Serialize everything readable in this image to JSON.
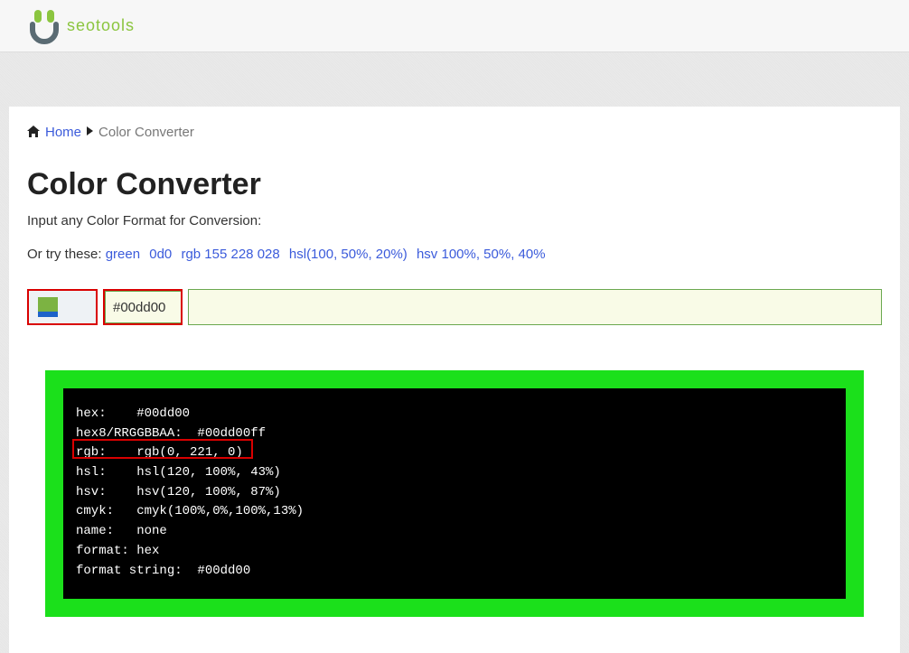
{
  "logo": {
    "text": "seotools"
  },
  "breadcrumb": {
    "home": "Home",
    "current": "Color Converter"
  },
  "title": "Color Converter",
  "subheading": "Input any Color Format for Conversion:",
  "try_label": "Or try these: ",
  "try_examples": {
    "a": "green",
    "b": "0d0",
    "c": "rgb 155 228 028",
    "d": "hsl(100, 50%, 20%)",
    "e": "hsv 100%, 50%, 40%"
  },
  "input": {
    "value": "#00dd00"
  },
  "result": {
    "hex": "hex:    #00dd00",
    "hex8": "hex8/RRGGBBAA:  #00dd00ff",
    "rgb": "rgb:    rgb(0, 221, 0)",
    "hsl": "hsl:    hsl(120, 100%, 43%)",
    "hsv": "hsv:    hsv(120, 100%, 87%)",
    "cmyk": "cmyk:   cmyk(100%,0%,100%,13%)",
    "name": "name:   none",
    "format": "format: hex",
    "fstring": "format string:  #00dd00"
  }
}
